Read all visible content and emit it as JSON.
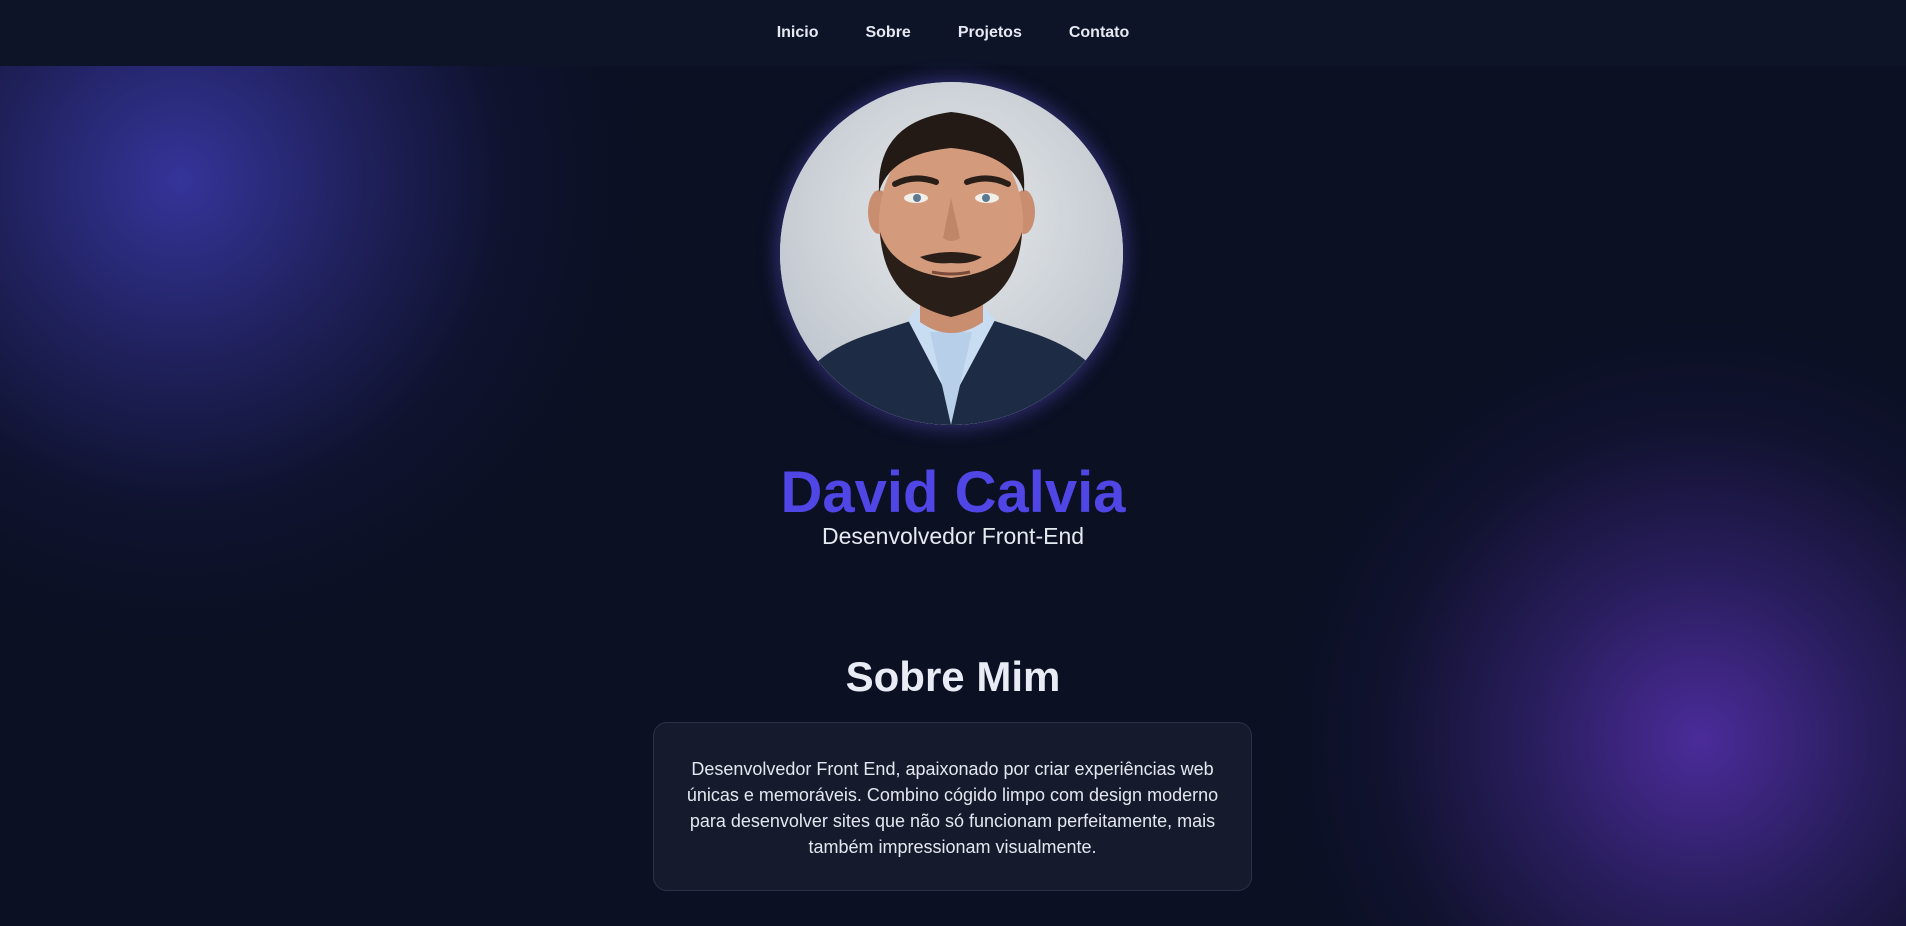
{
  "nav": {
    "items": [
      {
        "label": "Inicio"
      },
      {
        "label": "Sobre"
      },
      {
        "label": "Projetos"
      },
      {
        "label": "Contato"
      }
    ]
  },
  "hero": {
    "name": "David Calvia",
    "role": "Desenvolvedor Front-End",
    "avatar_icon": "profile-photo"
  },
  "about": {
    "title": "Sobre Mim",
    "text": "Desenvolvedor Front End, apaixonado por criar experiências web únicas e memoráveis. Combino cógido limpo com design moderno para desenvolver sites que não só funcionam perfeitamente, mais também impressionam visualmente."
  },
  "colors": {
    "background": "#0b1023",
    "navbar": "#0d1428",
    "accent": "#4f46e5",
    "card": "#151b2d",
    "glow_left": "#3736a0",
    "glow_right": "#4e2da0"
  }
}
